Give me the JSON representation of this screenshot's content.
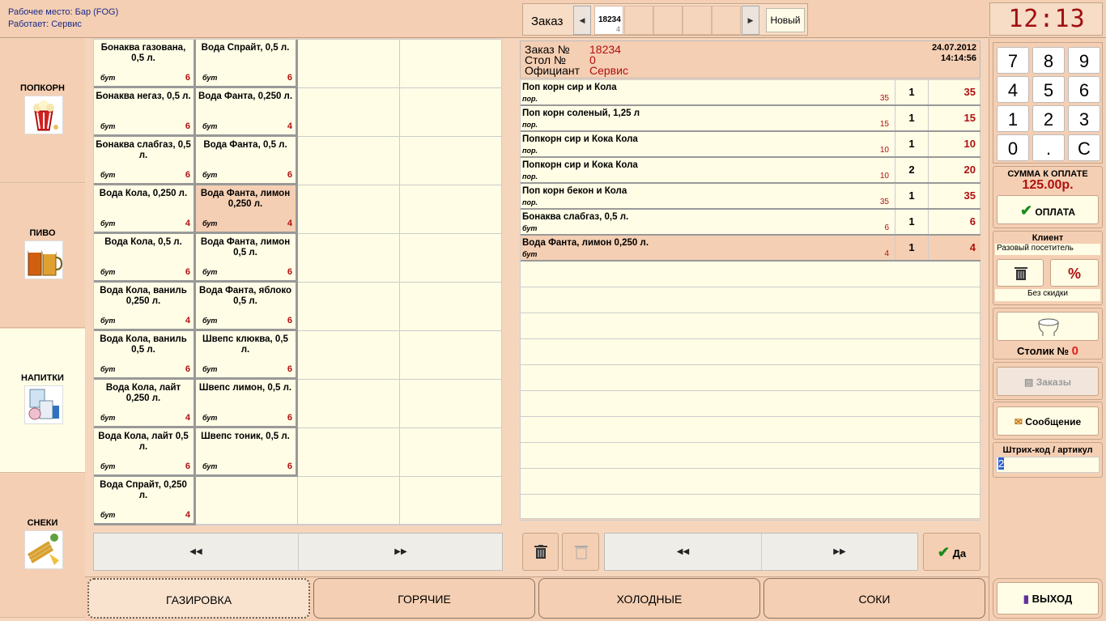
{
  "workstation": {
    "place_line": "Рабочее место: Бар  (FOG)",
    "user_line": "Работает: Сервис"
  },
  "order_strip": {
    "label": "Заказ",
    "current_order_number": "18234",
    "current_order_count": "4",
    "new_label": "Новый"
  },
  "clock": "12:13",
  "categories": [
    {
      "label": "ПОПКОРН",
      "icon": "popcorn-icon"
    },
    {
      "label": "ПИВО",
      "icon": "beer-icon"
    },
    {
      "label": "НАПИТКИ",
      "icon": "drinks-icon"
    },
    {
      "label": "СНЕКИ",
      "icon": "snacks-icon"
    }
  ],
  "products": [
    {
      "name": "Бонаква газована, 0,5 л.",
      "unit": "бут",
      "price": "6"
    },
    {
      "name": "Вода Спрайт, 0,5 л.",
      "unit": "бут",
      "price": "6"
    },
    {
      "name": "Бонаква негаз, 0,5 л.",
      "unit": "бут",
      "price": "6"
    },
    {
      "name": "Вода Фанта, 0,250 л.",
      "unit": "бут",
      "price": "4"
    },
    {
      "name": "Бонаква слабгаз, 0,5 л.",
      "unit": "бут",
      "price": "6"
    },
    {
      "name": "Вода Фанта, 0,5 л.",
      "unit": "бут",
      "price": "6"
    },
    {
      "name": "Вода Кола, 0,250 л.",
      "unit": "бут",
      "price": "4"
    },
    {
      "name": "Вода Фанта, лимон 0,250 л.",
      "unit": "бут",
      "price": "4"
    },
    {
      "name": "Вода Кола, 0,5 л.",
      "unit": "бут",
      "price": "6"
    },
    {
      "name": "Вода Фанта, лимон 0,5 л.",
      "unit": "бут",
      "price": "6"
    },
    {
      "name": "Вода Кола, ваниль 0,250 л.",
      "unit": "бут",
      "price": "4"
    },
    {
      "name": "Вода Фанта, яблоко 0,5 л.",
      "unit": "бут",
      "price": "6"
    },
    {
      "name": "Вода Кола, ваниль 0,5 л.",
      "unit": "бут",
      "price": "6"
    },
    {
      "name": "Швепс клюква, 0,5 л.",
      "unit": "бут",
      "price": "6"
    },
    {
      "name": "Вода Кола, лайт 0,250 л.",
      "unit": "бут",
      "price": "4"
    },
    {
      "name": "Швепс лимон, 0,5 л.",
      "unit": "бут",
      "price": "6"
    },
    {
      "name": "Вода Кола, лайт 0,5 л.",
      "unit": "бут",
      "price": "6"
    },
    {
      "name": "Швепс тоник, 0,5 л.",
      "unit": "бут",
      "price": "6"
    },
    {
      "name": "Вода Спрайт, 0,250 л.",
      "unit": "бут",
      "price": "4"
    }
  ],
  "order": {
    "number_label": "Заказ №",
    "number": "18234",
    "table_label": "Стол   №",
    "table": "0",
    "waiter_label": "Официант",
    "waiter": "Сервис",
    "date": "24.07.2012",
    "time": "14:14:56",
    "lines": [
      {
        "name": "Поп корн сир и Кола",
        "unit": "пор.",
        "price": "35",
        "qty": "1",
        "sum": "35"
      },
      {
        "name": "Поп корн соленый, 1,25 л",
        "unit": "пор.",
        "price": "15",
        "qty": "1",
        "sum": "15"
      },
      {
        "name": "Попкорн сир и Кока Кола",
        "unit": "пор.",
        "price": "10",
        "qty": "1",
        "sum": "10"
      },
      {
        "name": "Попкорн сир и Кока Кола",
        "unit": "пор.",
        "price": "10",
        "qty": "2",
        "sum": "20"
      },
      {
        "name": "Поп корн бекон и Кола",
        "unit": "пор.",
        "price": "35",
        "qty": "1",
        "sum": "35"
      },
      {
        "name": "Бонаква слабгаз, 0,5 л.",
        "unit": "бут",
        "price": "6",
        "qty": "1",
        "sum": "6"
      },
      {
        "name": "Вода Фанта, лимон 0,250 л.",
        "unit": "бут",
        "price": "4",
        "qty": "1",
        "sum": "4"
      }
    ]
  },
  "keypad": [
    "7",
    "8",
    "9",
    "4",
    "5",
    "6",
    "1",
    "2",
    "3",
    "0",
    ".",
    "C"
  ],
  "payment": {
    "label": "СУММА К ОПЛАТЕ",
    "amount": "125.00р.",
    "pay_button": "ОПЛАТА"
  },
  "client": {
    "title": "Клиент",
    "name": "Разовый посетитель",
    "discount": "Без скидки",
    "percent": "%"
  },
  "table_button": {
    "label": "Столик №",
    "value": "0"
  },
  "orders_button": "Заказы",
  "message_button": "Сообщение",
  "barcode": {
    "label": "Штрих-код / артикул",
    "value": "2"
  },
  "ok_button": "Да",
  "exit_button": "ВЫХОД",
  "bottom_tabs": [
    "ГАЗИРОВКА",
    "ГОРЯЧИЕ",
    "ХОЛОДНЫЕ",
    "СОКИ"
  ],
  "colors": {
    "accent_red": "#b01010",
    "panel_peach": "#f5cfb3",
    "cell_cream": "#fffde6"
  }
}
